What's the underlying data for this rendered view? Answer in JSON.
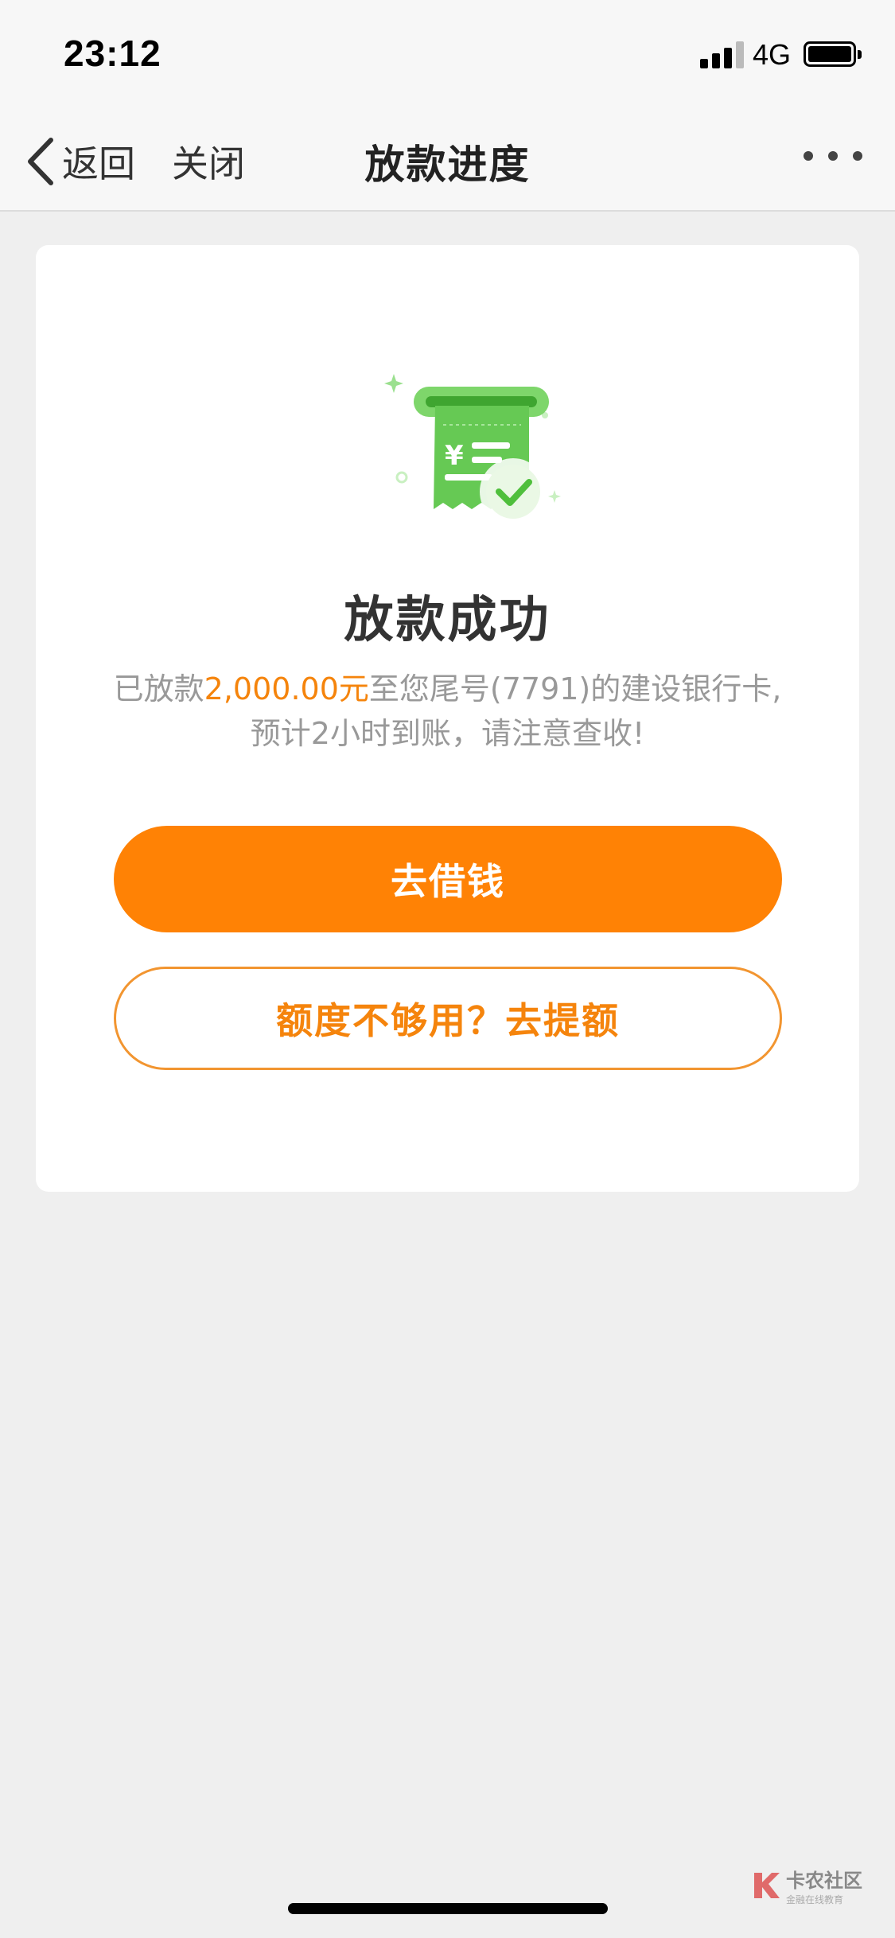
{
  "status_bar": {
    "time": "23:12",
    "network": "4G",
    "icons": [
      "signal-icon",
      "battery-icon"
    ]
  },
  "nav": {
    "back_label": "返回",
    "close_label": "关闭",
    "title": "放款进度",
    "icons": [
      "chevron-left-icon",
      "more-icon"
    ]
  },
  "result": {
    "illustration": "receipt-success-icon",
    "title": "放款成功",
    "desc_prefix": "已放款",
    "amount": "2,000.00元",
    "desc_suffix": "至您尾号(7791)的建设银行卡,",
    "desc_line2": "预计2小时到账，请注意查收!"
  },
  "actions": {
    "primary_label": "去借钱",
    "secondary_label": "额度不够用？去提额"
  },
  "watermark": {
    "title": "卡农社区",
    "subtitle": "金融在线教育"
  },
  "colors": {
    "accent": "#ff8205",
    "accent_text": "#f5840c",
    "success_green": "#5ac54a",
    "background": "#efefef"
  }
}
